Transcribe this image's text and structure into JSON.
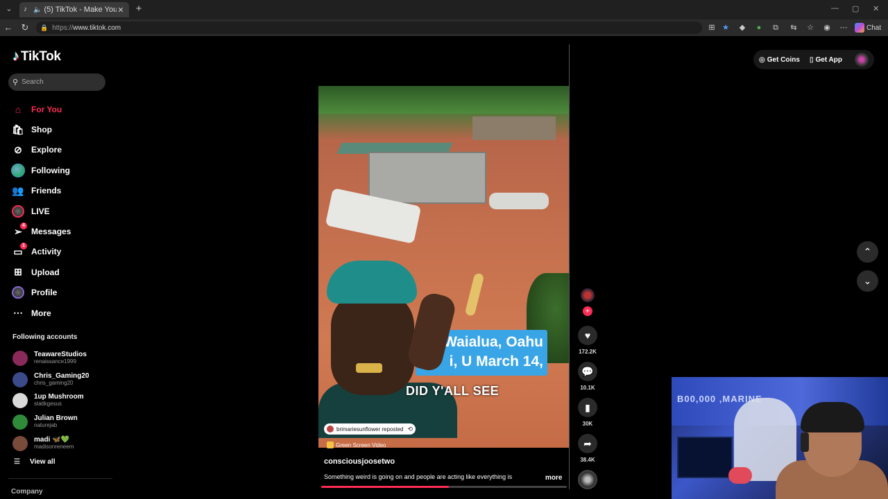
{
  "browser": {
    "tab_title": "(5) TikTok - Make Your Day",
    "url_scheme": "https://",
    "url_host": "www.tiktok.com",
    "chat_label": "Chat"
  },
  "brand": {
    "name": "TikTok",
    "accent": "#fe2c55"
  },
  "search": {
    "placeholder": "Search"
  },
  "nav": {
    "items": [
      {
        "label": "For You",
        "icon": "home-icon"
      },
      {
        "label": "Shop",
        "icon": "shop-icon"
      },
      {
        "label": "Explore",
        "icon": "compass-icon"
      },
      {
        "label": "Following",
        "icon": "following-avatar-icon"
      },
      {
        "label": "Friends",
        "icon": "friends-icon"
      },
      {
        "label": "LIVE",
        "icon": "live-icon"
      },
      {
        "label": "Messages",
        "icon": "messages-icon",
        "badge": "4"
      },
      {
        "label": "Activity",
        "icon": "activity-icon",
        "badge": "1"
      },
      {
        "label": "Upload",
        "icon": "upload-icon"
      },
      {
        "label": "Profile",
        "icon": "profile-icon"
      },
      {
        "label": "More",
        "icon": "more-icon"
      }
    ]
  },
  "following_accounts": {
    "heading": "Following accounts",
    "items": [
      {
        "name": "TeawareStudios",
        "handle": "renaissance1999",
        "color": "#8a2a5a"
      },
      {
        "name": "Chris_Gaming20",
        "handle": "chris_gaming20",
        "color": "#3a4a8a"
      },
      {
        "name": "1up Mushroom",
        "handle": "statikgesus",
        "color": "#d9d9d9"
      },
      {
        "name": "Julian Brown",
        "handle": "naturejab",
        "color": "#2f8a3a"
      },
      {
        "name": "madi 🦋💚",
        "handle": "madisonreneem",
        "color": "#7a4a3a"
      }
    ],
    "view_all": "View all"
  },
  "footer": {
    "company": "Company"
  },
  "video": {
    "caption_line1": "In Waialua, Oahu",
    "caption_line2": "i, U March 14,",
    "caption_line3": "DID Y'ALL SEE",
    "repost_text": "brimariesunflower reposted",
    "effect_label": "Green Screen Video",
    "author": "consciousjoosetwo",
    "description": "Something weird is going on and people are acting like everything is",
    "more_label": "more",
    "progress_fraction": 0.52
  },
  "actions": {
    "likes": "172.2K",
    "comments": "10.1K",
    "saves": "30K",
    "shares": "38.4K"
  },
  "topright": {
    "coins": "Get Coins",
    "app": "Get App"
  },
  "webcam": {
    "wall_text": "B00,000 ,MARINE"
  }
}
